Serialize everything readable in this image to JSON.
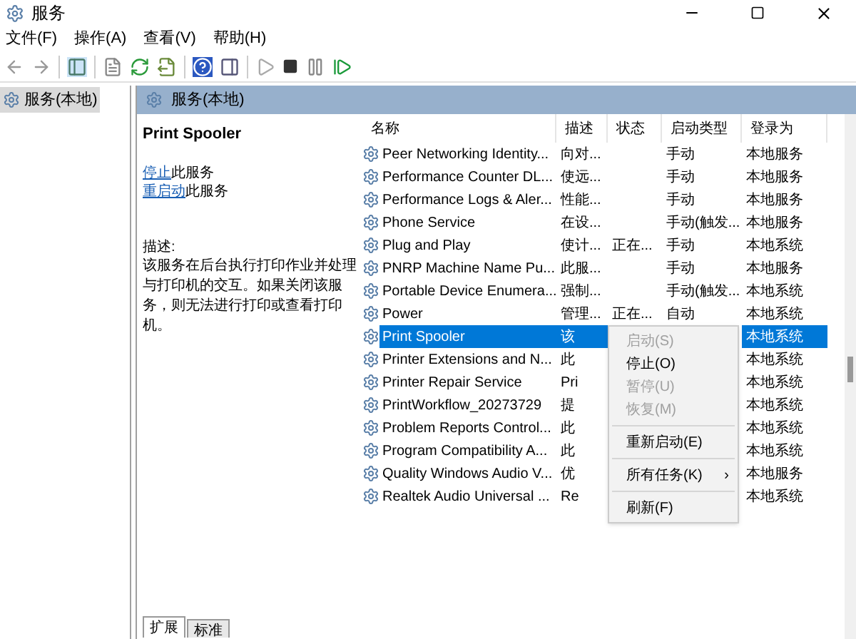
{
  "window": {
    "title": "服务"
  },
  "menu": [
    "文件(F)",
    "操作(A)",
    "查看(V)",
    "帮助(H)"
  ],
  "tree": [
    {
      "label": "服务(本地)",
      "selected": true
    }
  ],
  "panel_title": "服务(本地)",
  "detail": {
    "service_name": "Print Spooler",
    "actions": [
      {
        "link": "停止",
        "rest": "此服务"
      },
      {
        "link": "重启动",
        "rest": "此服务"
      }
    ],
    "description_label": "描述:",
    "description": "该服务在后台执行打印作业并处理与打印机的交互。如果关闭该服务，则无法进行打印或查看打印机。"
  },
  "table": {
    "columns": [
      "名称",
      "描述",
      "状态",
      "启动类型",
      "登录为"
    ],
    "rows": [
      {
        "name": "Peer Networking Identity...",
        "description": "向对...",
        "status": "",
        "startup": "手动",
        "logon": "本地服务",
        "selected": false
      },
      {
        "name": "Performance Counter DL...",
        "description": "使远...",
        "status": "",
        "startup": "手动",
        "logon": "本地服务",
        "selected": false
      },
      {
        "name": "Performance Logs & Aler...",
        "description": "性能...",
        "status": "",
        "startup": "手动",
        "logon": "本地服务",
        "selected": false
      },
      {
        "name": "Phone Service",
        "description": "在设...",
        "status": "",
        "startup": "手动(触发...",
        "logon": "本地服务",
        "selected": false
      },
      {
        "name": "Plug and Play",
        "description": "使计...",
        "status": "正在...",
        "startup": "手动",
        "logon": "本地系统",
        "selected": false
      },
      {
        "name": "PNRP Machine Name Pu...",
        "description": "此服...",
        "status": "",
        "startup": "手动",
        "logon": "本地服务",
        "selected": false
      },
      {
        "name": "Portable Device Enumera...",
        "description": "强制...",
        "status": "",
        "startup": "手动(触发...",
        "logon": "本地系统",
        "selected": false
      },
      {
        "name": "Power",
        "description": "管理...",
        "status": "正在...",
        "startup": "自动",
        "logon": "本地系统",
        "selected": false
      },
      {
        "name": "Print Spooler",
        "description": "该",
        "status": "",
        "startup": "",
        "logon": "本地系统",
        "selected": true
      },
      {
        "name": "Printer Extensions and N...",
        "description": "此",
        "status": "",
        "startup": "",
        "logon": "本地系统",
        "selected": false
      },
      {
        "name": "Printer Repair Service",
        "description": "Pri",
        "status": "",
        "startup": "",
        "logon": "本地系统",
        "selected": false
      },
      {
        "name": "PrintWorkflow_20273729",
        "description": "提",
        "status": "",
        "startup": "",
        "logon": "本地系统",
        "selected": false
      },
      {
        "name": "Problem Reports Control...",
        "description": "此",
        "status": "",
        "startup": "",
        "logon": "本地系统",
        "selected": false
      },
      {
        "name": "Program Compatibility A...",
        "description": "此",
        "status": "",
        "startup": "",
        "logon": "本地系统",
        "selected": false
      },
      {
        "name": "Quality Windows Audio V...",
        "description": "优",
        "status": "",
        "startup": "",
        "logon": "本地服务",
        "selected": false
      },
      {
        "name": "Realtek Audio Universal ...",
        "description": "Re",
        "status": "",
        "startup": "",
        "logon": "本地系统",
        "selected": false
      }
    ]
  },
  "context_menu": [
    {
      "kind": "item",
      "label": "启动(S)",
      "disabled": true
    },
    {
      "kind": "item",
      "label": "停止(O)",
      "disabled": false
    },
    {
      "kind": "item",
      "label": "暂停(U)",
      "disabled": true
    },
    {
      "kind": "item",
      "label": "恢复(M)",
      "disabled": true
    },
    {
      "kind": "separator"
    },
    {
      "kind": "item",
      "label": "重新启动(E)",
      "disabled": false
    },
    {
      "kind": "separator"
    },
    {
      "kind": "submenu",
      "label": "所有任务(K)",
      "arrow": "›",
      "disabled": false
    },
    {
      "kind": "separator"
    },
    {
      "kind": "item",
      "label": "刷新(F)",
      "disabled": false
    }
  ],
  "tabs": [
    {
      "label": "扩展",
      "selected": true
    },
    {
      "label": "标准",
      "selected": false
    }
  ]
}
